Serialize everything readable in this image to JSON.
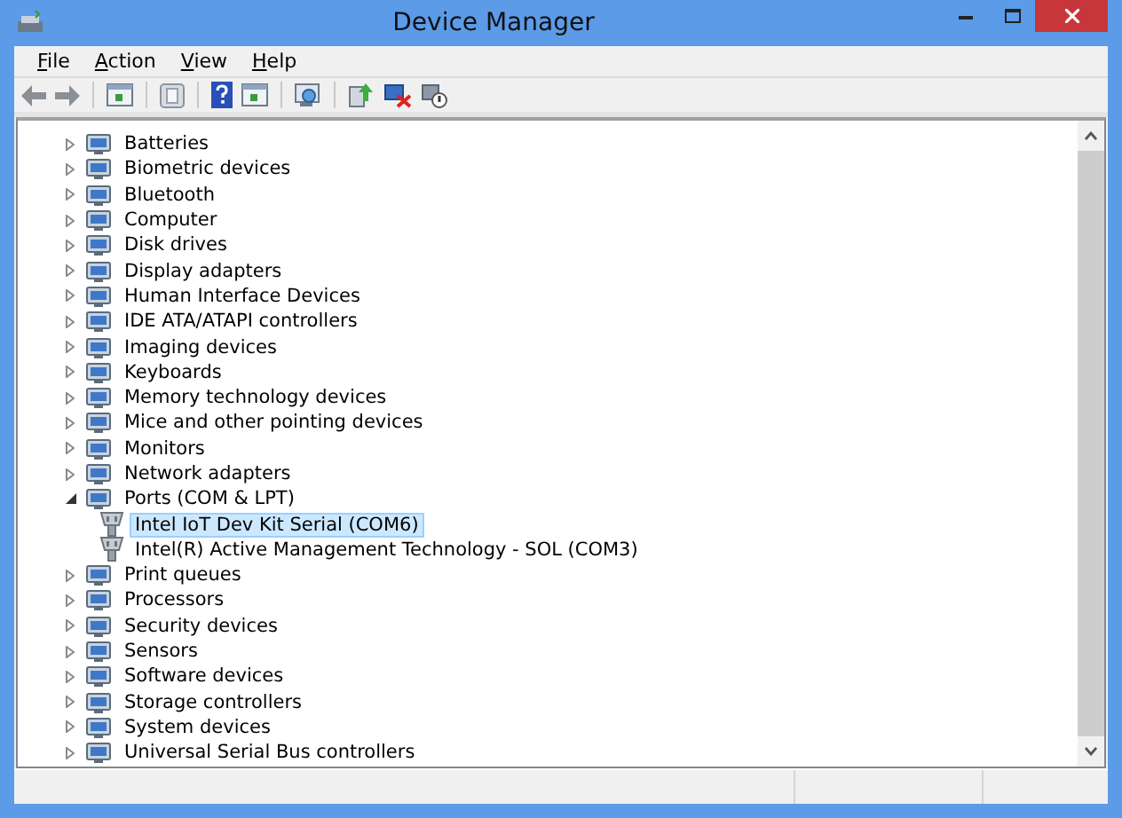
{
  "window": {
    "title": "Device Manager"
  },
  "menu": [
    "File",
    "Action",
    "View",
    "Help"
  ],
  "tree": [
    {
      "label": "Batteries",
      "expanded": false,
      "selected": false
    },
    {
      "label": "Biometric devices",
      "expanded": false,
      "selected": false
    },
    {
      "label": "Bluetooth",
      "expanded": false,
      "selected": false
    },
    {
      "label": "Computer",
      "expanded": false,
      "selected": false
    },
    {
      "label": "Disk drives",
      "expanded": false,
      "selected": false
    },
    {
      "label": "Display adapters",
      "expanded": false,
      "selected": false
    },
    {
      "label": "Human Interface Devices",
      "expanded": false,
      "selected": false
    },
    {
      "label": "IDE ATA/ATAPI controllers",
      "expanded": false,
      "selected": false
    },
    {
      "label": "Imaging devices",
      "expanded": false,
      "selected": false
    },
    {
      "label": "Keyboards",
      "expanded": false,
      "selected": false
    },
    {
      "label": "Memory technology devices",
      "expanded": false,
      "selected": false
    },
    {
      "label": "Mice and other pointing devices",
      "expanded": false,
      "selected": false
    },
    {
      "label": "Monitors",
      "expanded": false,
      "selected": false
    },
    {
      "label": "Network adapters",
      "expanded": false,
      "selected": false
    },
    {
      "label": "Ports (COM & LPT)",
      "expanded": true,
      "selected": false,
      "children": [
        {
          "label": "Intel IoT Dev Kit Serial (COM6)",
          "selected": true
        },
        {
          "label": "Intel(R) Active Management Technology - SOL (COM3)",
          "selected": false
        }
      ]
    },
    {
      "label": "Print queues",
      "expanded": false,
      "selected": false
    },
    {
      "label": "Processors",
      "expanded": false,
      "selected": false
    },
    {
      "label": "Security devices",
      "expanded": false,
      "selected": false
    },
    {
      "label": "Sensors",
      "expanded": false,
      "selected": false
    },
    {
      "label": "Software devices",
      "expanded": false,
      "selected": false
    },
    {
      "label": "Storage controllers",
      "expanded": false,
      "selected": false
    },
    {
      "label": "System devices",
      "expanded": false,
      "selected": false
    },
    {
      "label": "Universal Serial Bus controllers",
      "expanded": false,
      "selected": false
    }
  ]
}
